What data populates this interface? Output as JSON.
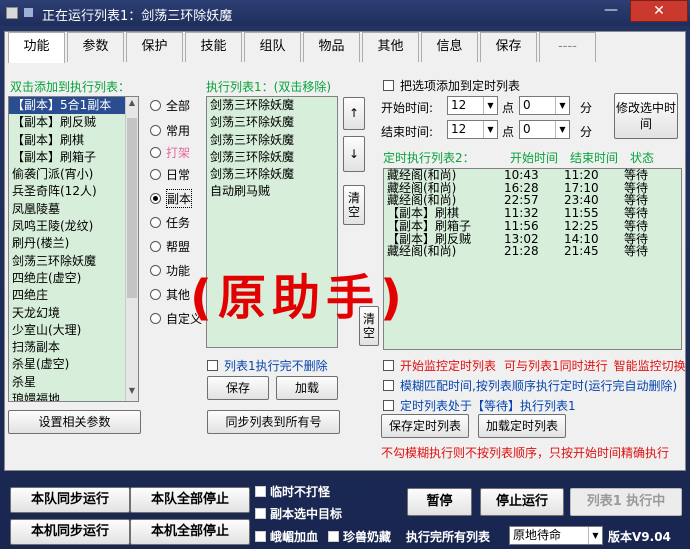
{
  "window": {
    "title": "正在运行列表1：剑荡三环除妖魔",
    "close": "✕",
    "minimize": "—"
  },
  "tabs": [
    {
      "label": "功能"
    },
    {
      "label": "参数"
    },
    {
      "label": "保护"
    },
    {
      "label": "技能"
    },
    {
      "label": "组队"
    },
    {
      "label": "物品"
    },
    {
      "label": "其他"
    },
    {
      "label": "信息"
    },
    {
      "label": "保存"
    },
    {
      "label": "----"
    }
  ],
  "left": {
    "header": "双击添加到执行列表：",
    "items": [
      "【副本】5合1副本",
      "【副本】刷反贼",
      "【副本】刷棋",
      "【副本】刷箱子",
      "偷袭门派(宵小)",
      "兵圣奇阵(12人)",
      "凤凰陵墓",
      "凤鸣王陵(龙纹)",
      "刷丹(楼兰)",
      "剑荡三环除妖魔",
      "四绝庄(虚空)",
      "四绝庄",
      "天龙幻境",
      "少室山(大理)",
      "扫荡副本",
      "杀星(虚空)",
      "杀星",
      "琅嬛福地"
    ],
    "selected_index": 0,
    "settings_button": "设置相关参数"
  },
  "radios": [
    {
      "label": "全部"
    },
    {
      "label": "常用"
    },
    {
      "label": "打架"
    },
    {
      "label": "日常"
    },
    {
      "label": "副本"
    },
    {
      "label": "任务"
    },
    {
      "label": "帮盟"
    },
    {
      "label": "功能"
    },
    {
      "label": "其他"
    },
    {
      "label": "自定义"
    }
  ],
  "radio_selected": "副本",
  "exec": {
    "header": "执行列表1：(双击移除)",
    "items": [
      "剑荡三环除妖魔",
      "剑荡三环除妖魔",
      "剑荡三环除妖魔",
      "剑荡三环除妖魔",
      "剑荡三环除妖魔",
      "自动刷马贼"
    ],
    "up": "↑",
    "down": "↓",
    "clear1": "清空",
    "clear2": "清空",
    "no_delete": "列表1执行完不删除",
    "save": "保存",
    "load": "加载",
    "sync": "同步列表到所有号"
  },
  "timer": {
    "add_checkbox": "把选项添加到定时列表",
    "start_label": "开始时间:",
    "end_label": "结束时间:",
    "start_hour": "12",
    "start_min": "0",
    "end_hour": "12",
    "end_min": "0",
    "point": "点",
    "minute": "分",
    "modify_button": "修改选中时间",
    "list_header": "定时执行列表2：",
    "col_start": "开始时间",
    "col_end": "结束时间",
    "col_status": "状态",
    "rows": [
      [
        "藏经阁(和尚)",
        "10:43",
        "11:20",
        "等待"
      ],
      [
        "藏经阁(和尚)",
        "16:28",
        "17:10",
        "等待"
      ],
      [
        "藏经阁(和尚)",
        "22:57",
        "23:40",
        "等待"
      ],
      [
        "【副本】刷棋",
        "11:32",
        "11:55",
        "等待"
      ],
      [
        "【副本】刷箱子",
        "11:56",
        "12:25",
        "等待"
      ],
      [
        "【副本】刷反贼",
        "13:02",
        "14:10",
        "等待"
      ],
      [
        "藏经阁(和尚)",
        "21:28",
        "21:45",
        "等待"
      ]
    ],
    "opt1": "开始监控定时列表",
    "opt1_note": "可与列表1同时进行",
    "opt1_note2": "智能监控切换",
    "opt2": "模糊匹配时间,按列表顺序执行定时(运行完自动删除)",
    "opt3": "定时列表处于【等待】执行列表1",
    "save_timer": "保存定时列表",
    "load_timer": "加载定时列表",
    "warning": "不勾模糊执行则不按列表顺序，只按开始时间精确执行"
  },
  "watermark": "(原助手)",
  "bottom": {
    "team_sync_run": "本队同步运行",
    "team_stop_all": "本队全部停止",
    "local_sync_run": "本机同步运行",
    "local_stop_all": "本机全部停止",
    "no_fight": "临时不打怪",
    "dungeon_target": "副本选中目标",
    "peak_add_blood": "峨嵋加血",
    "pet_milk": "珍兽奶藏",
    "after_list": "执行完所有列表",
    "after_select": "原地待命",
    "pause": "暂停",
    "stop_run": "停止运行",
    "list1_running": "列表1 执行中",
    "version": "版本V9.04"
  },
  "colors": {
    "green_label": "#07a33a",
    "red": "#e01010",
    "blue": "#0645ad",
    "list_bg": "#d7eedb",
    "window": "#1c2a55"
  }
}
